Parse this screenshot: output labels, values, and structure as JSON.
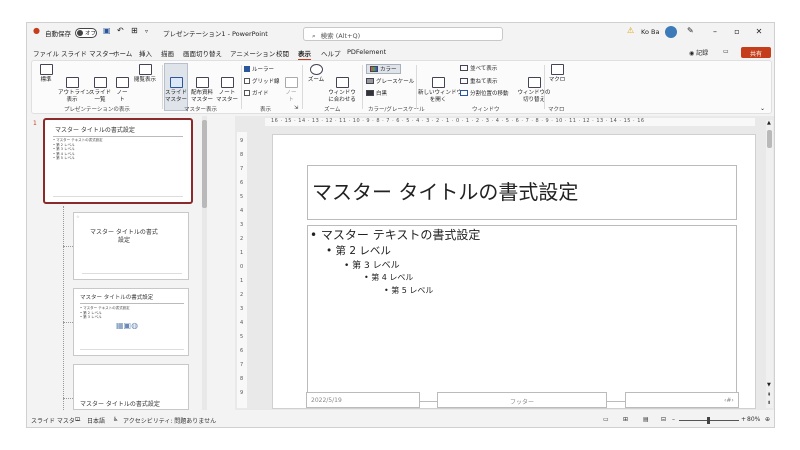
{
  "titlebar": {
    "autosave_label": "自動保存",
    "autosave_state": "オフ",
    "filename": "プレゼンテーション1 - PowerPoint",
    "search_placeholder": "検索 (Alt+Q)",
    "user_name": "Ko Ba",
    "warning": "⚠"
  },
  "menu": {
    "tabs": [
      "ファイル",
      "スライド マスター",
      "ホーム",
      "挿入",
      "描画",
      "画面切り替え",
      "アニメーション",
      "校閲",
      "表示",
      "ヘルプ",
      "PDFelement"
    ],
    "active_index": 8,
    "record": "◉ 記録",
    "share": "共有"
  },
  "ribbon": {
    "views": [
      "標準",
      "アウトライン\n表示",
      "スライド\n一覧",
      "ノー\nト",
      "閲覧表示"
    ],
    "views_group": "プレゼンテーションの表示",
    "master_views": [
      "スライド\nマスター",
      "配布資料\nマスター",
      "ノート\nマスター"
    ],
    "master_group": "マスター表示",
    "show_items": [
      "ルーラー",
      "グリッド線",
      "ガイド"
    ],
    "show_notes": "ノー\nト",
    "show_group": "表示",
    "zoom_items": [
      "ズーム",
      "ウィンドウ\nに合わせる"
    ],
    "zoom_group": "ズーム",
    "color_items": [
      "カラー",
      "グレースケール",
      "白黒"
    ],
    "color_group": "カラー/グレースケール",
    "window_new": "新しいウィンドウ\nを開く",
    "window_items": [
      "並べて表示",
      "重ねて表示",
      "分割位置の移動"
    ],
    "window_switch": "ウィンドウの\n切り替え",
    "window_group": "ウィンドウ",
    "macro": "マクロ",
    "macro_group": "マクロ"
  },
  "thumbnails": {
    "slide_number": "1",
    "master_title": "マスター タイトルの書式設定",
    "master_body": [
      "• マスター テキストの書式設定",
      "  • 第 2 レベル",
      "    • 第 3 レベル",
      "      • 第 4 レベル",
      "        • 第 5 レベル"
    ],
    "layout1_title": "マスター タイトルの書式\n設定",
    "layout2_title": "マスター タイトルの書式設定",
    "layout3_title": "マスター タイトルの書式設定"
  },
  "ruler": {
    "horizontal": "16 · 15 · 14 · 13 · 12 · 11 · 10 · 9 · 8 · 7 · 6 · 5 · 4 · 3 · 2 · 1 · 0 · 1 · 2 · 3 · 4 · 5 · 6 · 7 · 8 · 9 · 10 · 11 · 12 · 13 · 14 · 15 · 16",
    "vertical": [
      "9",
      "8",
      "7",
      "6",
      "5",
      "4",
      "3",
      "2",
      "1",
      "0",
      "1",
      "2",
      "3",
      "4",
      "5",
      "6",
      "7",
      "8",
      "9"
    ]
  },
  "slide": {
    "title": "マスター タイトルの書式設定",
    "bullets": [
      {
        "text": "• マスター テキストの書式設定",
        "level": 1
      },
      {
        "text": "• 第 2 レベル",
        "level": 2
      },
      {
        "text": "• 第 3 レベル",
        "level": 3
      },
      {
        "text": "• 第 4 レベル",
        "level": 4
      },
      {
        "text": "• 第 5 レベル",
        "level": 5
      }
    ],
    "date": "2022/5/19",
    "footer": "フッター",
    "page_number": "‹#›"
  },
  "status": {
    "view": "スライド マスター",
    "language": "日本語",
    "accessibility": "アクセシビリティ: 問題ありません",
    "zoom": "80%"
  },
  "colors": {
    "accent": "#c43e1c",
    "master_border": "#8b2a2a",
    "tab_underline": "#c43e1c"
  }
}
